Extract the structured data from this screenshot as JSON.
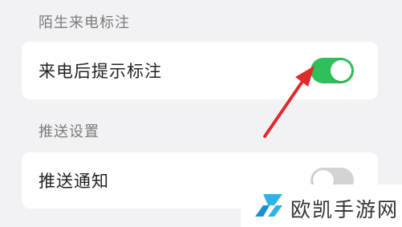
{
  "sections": [
    {
      "header": "陌生来电标注",
      "row": {
        "label": "来电后提示标注",
        "toggle_on": true
      }
    },
    {
      "header": "推送设置",
      "row": {
        "label": "推送通知",
        "toggle_on": false
      }
    }
  ],
  "colors": {
    "toggle_on": "#2fbf5b",
    "toggle_off": "#d3d3d6",
    "arrow": "#e12a2a",
    "background": "#f2f2f4"
  },
  "watermark": {
    "text": "欧凯手游网",
    "logo_icon": "ok-logo-icon"
  }
}
